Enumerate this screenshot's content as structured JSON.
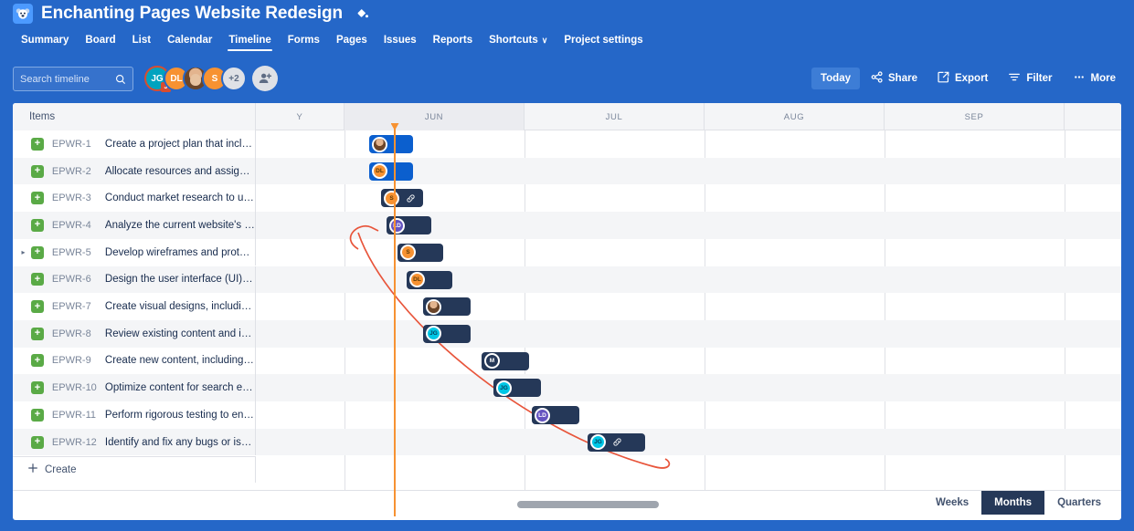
{
  "header": {
    "project_avatar_icon": "koala-avatar-icon",
    "title": "Enchanting Pages Website Redesign",
    "title_edit_icon": "paint-bucket-icon",
    "nav": [
      {
        "label": "Summary",
        "active": false
      },
      {
        "label": "Board",
        "active": false
      },
      {
        "label": "List",
        "active": false
      },
      {
        "label": "Calendar",
        "active": false
      },
      {
        "label": "Timeline",
        "active": true
      },
      {
        "label": "Forms",
        "active": false
      },
      {
        "label": "Pages",
        "active": false
      },
      {
        "label": "Issues",
        "active": false
      },
      {
        "label": "Reports",
        "active": false
      },
      {
        "label": "Shortcuts",
        "active": false,
        "caret": "∨"
      },
      {
        "label": "Project settings",
        "active": false
      }
    ]
  },
  "toolbar": {
    "search_placeholder": "Search timeline",
    "search_value": "",
    "search_icon": "search-icon",
    "avatars": [
      {
        "initials": "JG",
        "kind": "jg",
        "badge": "J"
      },
      {
        "initials": "DL",
        "kind": "dl"
      },
      {
        "initials": "",
        "kind": "photo"
      },
      {
        "initials": "S",
        "kind": "s"
      },
      {
        "initials": "+2",
        "kind": "more"
      }
    ],
    "add_people_icon": "add-person-icon",
    "buttons": [
      {
        "label": "Today",
        "icon": "",
        "selected": true
      },
      {
        "label": "Share",
        "icon": "share-icon",
        "selected": false
      },
      {
        "label": "Export",
        "icon": "export-icon",
        "selected": false
      },
      {
        "label": "Filter",
        "icon": "filter-icon",
        "selected": false
      },
      {
        "label": "More",
        "icon": "more-dots-icon",
        "selected": false
      }
    ]
  },
  "timeline": {
    "items_header": "Items",
    "months": [
      {
        "label": "Y",
        "current": false
      },
      {
        "label": "JUN",
        "current": true
      },
      {
        "label": "JUL",
        "current": false
      },
      {
        "label": "AUG",
        "current": false
      },
      {
        "label": "SEP",
        "current": false
      },
      {
        "label": "",
        "current": false
      }
    ],
    "create_label": "Create",
    "create_icon": "plus-icon",
    "today_marker_color": "#F79232",
    "dependency_color": "#E8553B",
    "rows": [
      {
        "key": "EPWR-1",
        "summary": "Create a project plan that includes al...",
        "expandable": false,
        "type_icon": "story-icon",
        "bar": {
          "color": "blue",
          "avatar": "photo",
          "avatar_label": "",
          "link": false
        }
      },
      {
        "key": "EPWR-2",
        "summary": "Allocate resources and assign roles ...",
        "expandable": false,
        "type_icon": "story-icon",
        "bar": {
          "color": "blue",
          "avatar": "dl",
          "avatar_label": "DL",
          "link": false
        }
      },
      {
        "key": "EPWR-3",
        "summary": "Conduct market research to underst...",
        "expandable": false,
        "type_icon": "story-icon",
        "bar": {
          "color": "navy",
          "avatar": "s",
          "avatar_label": "S",
          "link": true
        }
      },
      {
        "key": "EPWR-4",
        "summary": "Analyze the current website's streng...",
        "expandable": false,
        "type_icon": "story-icon",
        "bar": {
          "color": "navy",
          "avatar": "ld",
          "avatar_label": "LD",
          "link": false
        }
      },
      {
        "key": "EPWR-5",
        "summary": "Develop wireframes and prototypes ...",
        "expandable": true,
        "type_icon": "story-icon",
        "bar": {
          "color": "navy",
          "avatar": "s",
          "avatar_label": "S",
          "link": false
        }
      },
      {
        "key": "EPWR-6",
        "summary": "Design the user interface (UI) and us...",
        "expandable": false,
        "type_icon": "story-icon",
        "bar": {
          "color": "navy",
          "avatar": "dl",
          "avatar_label": "DL",
          "link": false
        }
      },
      {
        "key": "EPWR-7",
        "summary": "Create visual designs, including colo...",
        "expandable": false,
        "type_icon": "story-icon",
        "bar": {
          "color": "navy",
          "avatar": "photo",
          "avatar_label": "",
          "link": false
        }
      },
      {
        "key": "EPWR-8",
        "summary": "Review existing content and identify...",
        "expandable": false,
        "type_icon": "story-icon",
        "bar": {
          "color": "navy",
          "avatar": "jg",
          "avatar_label": "JG",
          "link": false
        }
      },
      {
        "key": "EPWR-9",
        "summary": "Create new content, including prod...",
        "expandable": false,
        "type_icon": "story-icon",
        "bar": {
          "color": "navy",
          "avatar": "m",
          "avatar_label": "M",
          "link": false
        }
      },
      {
        "key": "EPWR-10",
        "summary": "Optimize content for search engine...",
        "expandable": false,
        "type_icon": "story-icon",
        "bar": {
          "color": "navy",
          "avatar": "jg",
          "avatar_label": "JG",
          "link": false
        }
      },
      {
        "key": "EPWR-11",
        "summary": "Perform rigorous testing to ensure ...",
        "expandable": false,
        "type_icon": "story-icon",
        "bar": {
          "color": "navy",
          "avatar": "ld",
          "avatar_label": "LD",
          "link": false
        }
      },
      {
        "key": "EPWR-12",
        "summary": "Identify and fix any bugs or issues.",
        "expandable": false,
        "type_icon": "story-icon",
        "bar": {
          "color": "navy",
          "avatar": "jg",
          "avatar_label": "JG",
          "link": true
        }
      }
    ]
  },
  "footer": {
    "zoom_levels": [
      {
        "label": "Weeks",
        "selected": false
      },
      {
        "label": "Months",
        "selected": true
      },
      {
        "label": "Quarters",
        "selected": false
      }
    ]
  }
}
